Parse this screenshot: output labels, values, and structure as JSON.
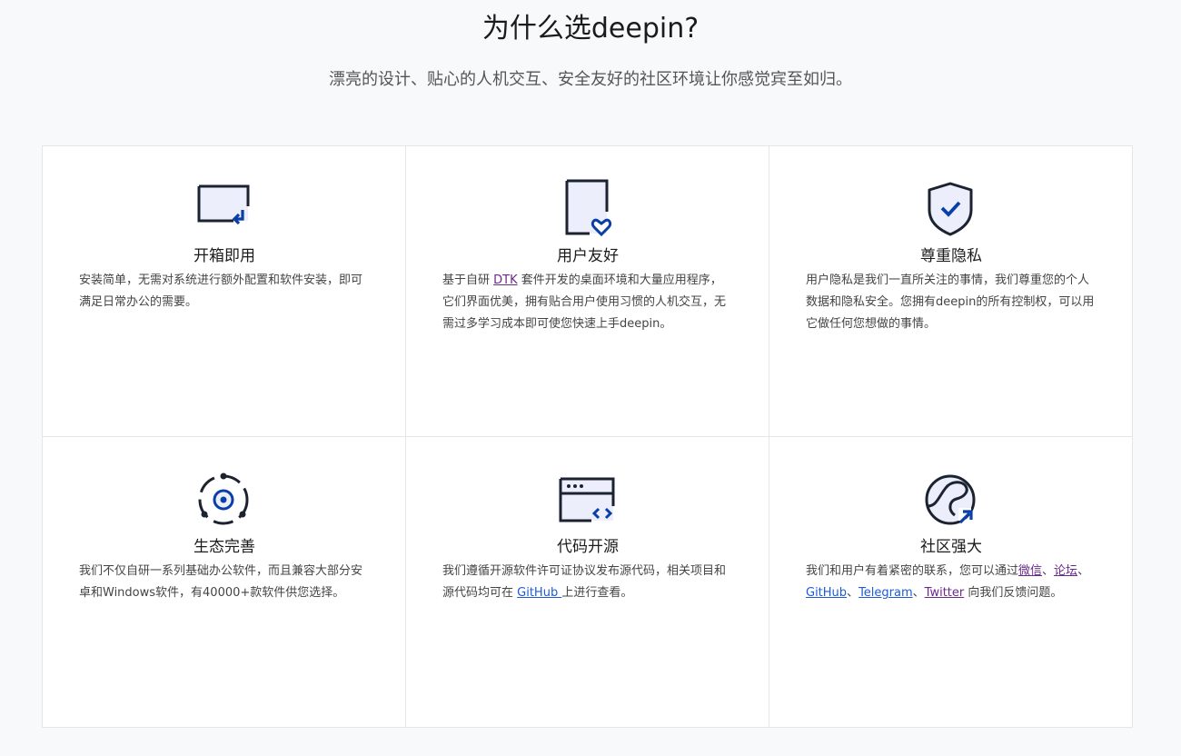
{
  "header": {
    "title": "为什么选deepin?",
    "subtitle": "漂亮的设计、贴心的人机交互、安全友好的社区环境让你感觉宾至如归。"
  },
  "colors": {
    "icon_dark": "#1b2230",
    "icon_accent": "#0a3fa8",
    "icon_fill": "#eceefb"
  },
  "features": [
    {
      "icon": "monitor-return-icon",
      "title": "开箱即用",
      "desc": "安装简单，无需对系统进行额外配置和软件安装，即可满足日常办公的需要。"
    },
    {
      "icon": "phone-heart-icon",
      "title": "用户友好",
      "desc_before": "基于自研 ",
      "link_dtk": "DTK",
      "desc_after": " 套件开发的桌面环境和大量应用程序，它们界面优美，拥有贴合用户使用习惯的人机交互，无需过多学习成本即可使您快速上手deepin。"
    },
    {
      "icon": "shield-check-icon",
      "title": "尊重隐私",
      "desc": "用户隐私是我们一直所关注的事情，我们尊重您的个人数据和隐私安全。您拥有deepin的所有控制权，可以用它做任何您想做的事情。"
    },
    {
      "icon": "ecosystem-orbit-icon",
      "title": "生态完善",
      "desc": "我们不仅自研一系列基础办公软件，而且兼容大部分安卓和Windows软件，有40000+款软件供您选择。"
    },
    {
      "icon": "code-window-icon",
      "title": "代码开源",
      "desc_before": "我们遵循开源软件许可证协议发布源代码，相关项目和源代码均可在 ",
      "link_github": "GitHub ",
      "desc_after": "上进行查看。"
    },
    {
      "icon": "community-globe-icon",
      "title": "社区强大",
      "desc_before": "我们和用户有着紧密的联系，您可以通过",
      "link_wechat": "微信",
      "sep1": "、",
      "link_forum": "论坛",
      "sep2": "、",
      "link_github": "GitHub",
      "sep3": "、",
      "link_telegram": "Telegram",
      "sep4": "、",
      "link_twitter": "Twitter",
      "desc_after": " 向我们反馈问题。"
    }
  ]
}
